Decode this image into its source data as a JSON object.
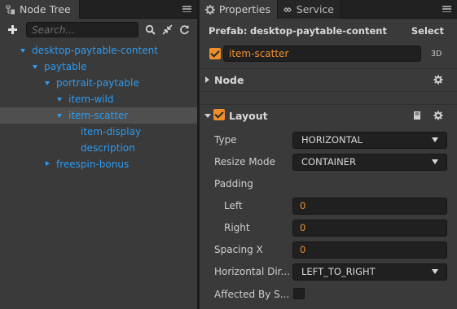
{
  "node_tree_panel": {
    "tab_label": "Node Tree",
    "search_placeholder": "Search...",
    "items": [
      {
        "label": "desktop-paytable-content",
        "depth": 0,
        "expander": "down"
      },
      {
        "label": "paytable",
        "depth": 1,
        "expander": "down"
      },
      {
        "label": "portrait-paytable",
        "depth": 2,
        "expander": "down"
      },
      {
        "label": "item-wild",
        "depth": 3,
        "expander": "down"
      },
      {
        "label": "item-scatter",
        "depth": 3,
        "expander": "down",
        "selected": true
      },
      {
        "label": "item-display",
        "depth": 4,
        "expander": "none"
      },
      {
        "label": "description",
        "depth": 4,
        "expander": "none"
      },
      {
        "label": "freespin-bonus",
        "depth": 2,
        "expander": "right"
      }
    ]
  },
  "properties_panel": {
    "tabs": [
      "Properties",
      "Service"
    ],
    "prefab_label": "Prefab:",
    "prefab_name": "desktop-paytable-content",
    "prefab_select": "Select",
    "node_name": "item-scatter",
    "node_active": true,
    "tag_3d": "3D",
    "sections": {
      "node": {
        "title": "Node",
        "expanded": false
      },
      "layout": {
        "title": "Layout",
        "expanded": true,
        "enabled": true
      }
    },
    "layout_props": {
      "type_label": "Type",
      "type_value": "HORIZONTAL",
      "resize_mode_label": "Resize Mode",
      "resize_mode_value": "CONTAINER",
      "padding_label": "Padding",
      "left_label": "Left",
      "left_value": "0",
      "right_label": "Right",
      "right_value": "0",
      "spacing_x_label": "Spacing X",
      "spacing_x_value": "0",
      "horizontal_dir_label": "Horizontal Dir...",
      "horizontal_dir_value": "LEFT_TO_RIGHT",
      "affected_label": "Affected By S...",
      "affected_value": false
    }
  },
  "colors": {
    "accent": "#f08f2a",
    "tree_text": "#2d9bf0",
    "panel_bg": "#3a3a3a",
    "field_bg": "#202020"
  },
  "icons": [
    "node-tree-icon",
    "gear-icon",
    "service-icon",
    "menu-icon",
    "plus-icon",
    "search-icon",
    "collapse-icon",
    "refresh-icon",
    "book-icon"
  ]
}
